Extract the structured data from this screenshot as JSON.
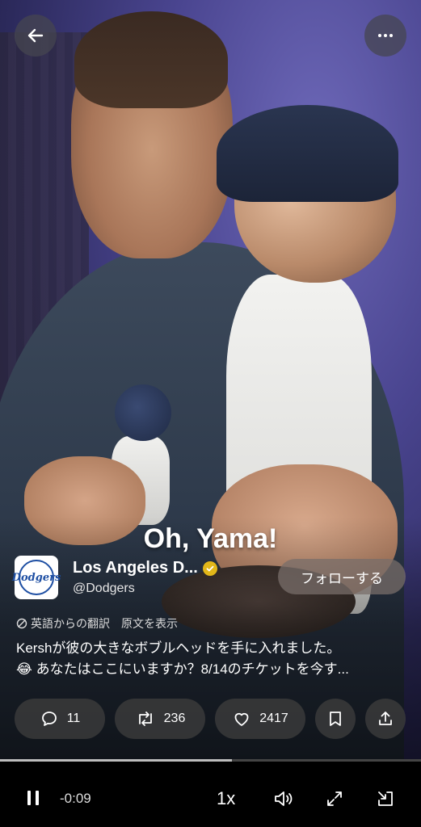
{
  "nav": {
    "back_icon": "arrow-left-icon",
    "more_icon": "more-horizontal-icon"
  },
  "video": {
    "caption": "Oh, Yama!",
    "progress_fraction": 0.55
  },
  "account": {
    "avatar_text": "Dodgers",
    "name": "Los Angeles D...",
    "handle": "@Dodgers",
    "verified": true,
    "follow_label": "フォローする"
  },
  "post": {
    "translation_note": "英語からの翻訳",
    "show_original": "原文を表示",
    "line1": "Kershが彼の大きなボブルヘッドを手に入れました。",
    "line2": "😂 あなたはここにいますか？8/14のチケットを今す..."
  },
  "actions": {
    "replies": "11",
    "reposts": "236",
    "likes": "2417"
  },
  "player": {
    "time_remaining": "-0:09",
    "speed": "1x"
  },
  "colors": {
    "verified_badge": "#e2b719",
    "brand_blue": "#1e4fa3"
  }
}
